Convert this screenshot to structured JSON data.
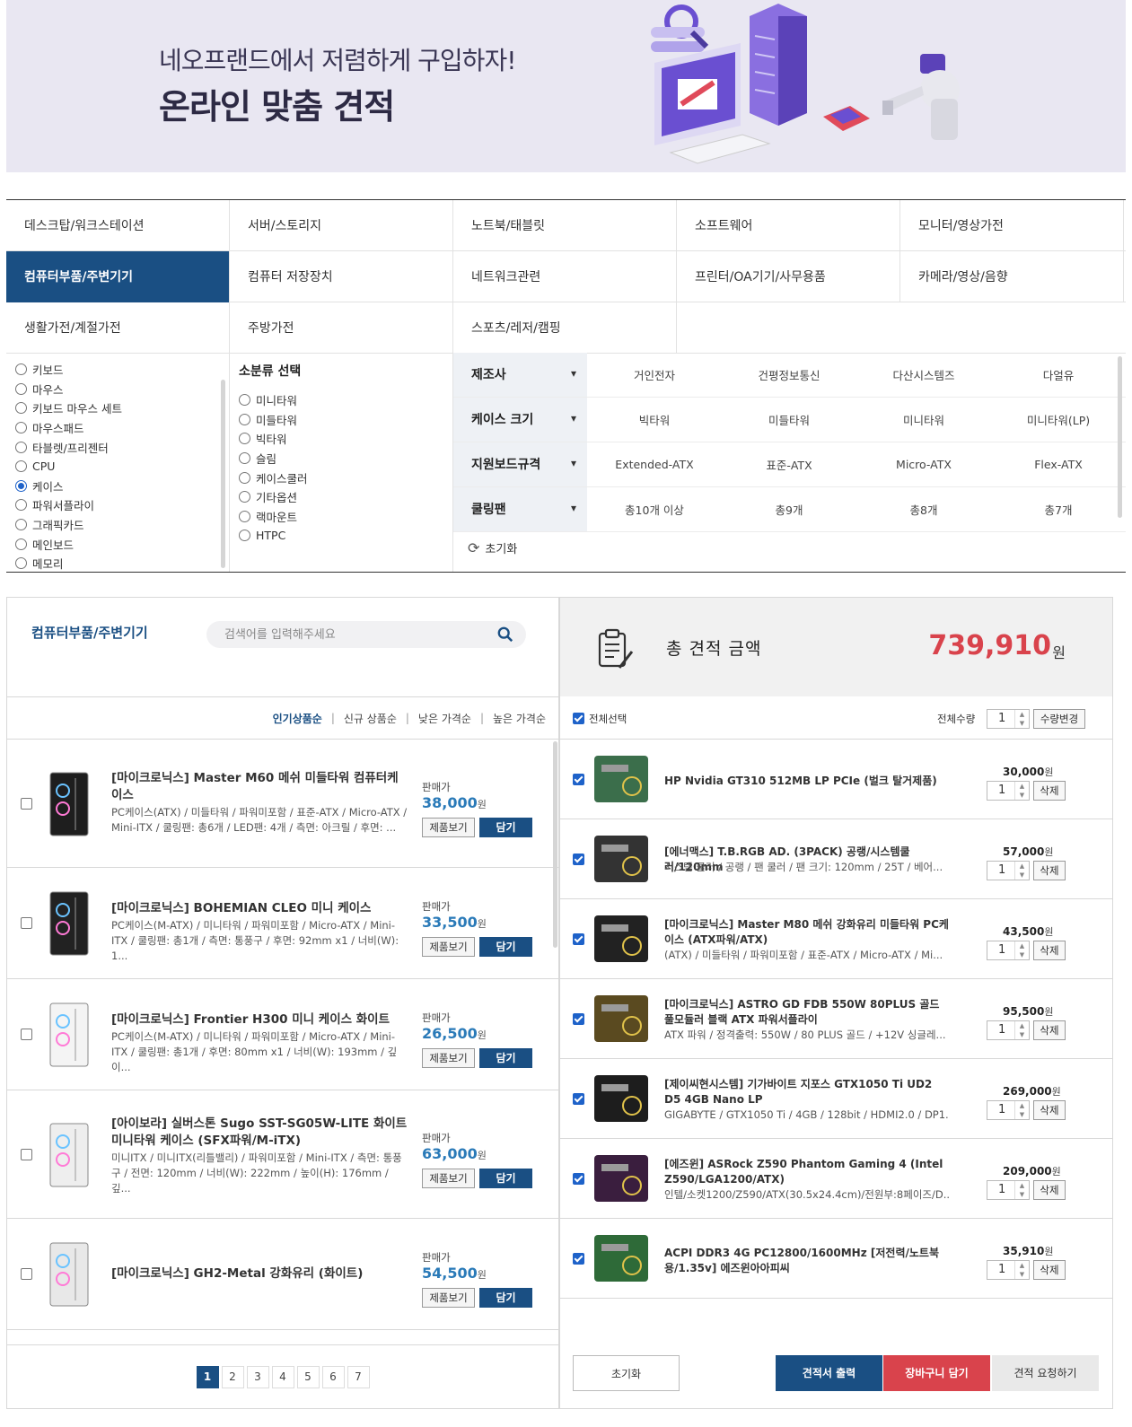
{
  "banner": {
    "subtitle": "네오프랜드에서 저렴하게 구입하자!",
    "title": "온라인 맞춤 견적"
  },
  "categories": [
    [
      "데스크탑/워크스테이션",
      "서버/스토리지",
      "노트북/태블릿",
      "소프트웨어",
      "모니터/영상가전"
    ],
    [
      "컴퓨터부품/주변기기",
      "컴퓨터 저장장치",
      "네트워크관련",
      "프린터/OA기기/사무용품",
      "카메라/영상/음향"
    ],
    [
      "생활가전/계절가전",
      "주방가전",
      "스포츠/레저/캠핑"
    ]
  ],
  "active_category": "컴퓨터부품/주변기기",
  "subcategories": [
    "키보드",
    "마우스",
    "키보드 마우스 세트",
    "마우스패드",
    "타블렛/프리젠터",
    "CPU",
    "케이스",
    "파워서플라이",
    "그래픽카드",
    "메인보드",
    "메모리"
  ],
  "active_subcategory": "케이스",
  "minor_head": "소분류 선택",
  "minor_options": [
    "미니타워",
    "미들타워",
    "빅타워",
    "슬림",
    "케이스쿨러",
    "기타옵션",
    "랙마운트",
    "HTPC"
  ],
  "filters": [
    {
      "key": "제조사",
      "values": [
        "거인전자",
        "건평정보통신",
        "다산시스템즈",
        "다얼유"
      ]
    },
    {
      "key": "케이스 크기",
      "values": [
        "빅타워",
        "미들타워",
        "미니타워",
        "미니타워(LP)"
      ]
    },
    {
      "key": "지원보드규격",
      "values": [
        "Extended-ATX",
        "표준-ATX",
        "Micro-ATX",
        "Flex-ATX"
      ]
    },
    {
      "key": "쿨링팬",
      "values": [
        "총10개 이상",
        "총9개",
        "총8개",
        "총7개"
      ]
    }
  ],
  "filter_reset": "초기화",
  "left": {
    "title": "컴퓨터부품/주변기기",
    "search_placeholder": "검색어를 입력해주세요",
    "sort": [
      "인기상품순",
      "신규 상품순",
      "낮은 가격순",
      "높은 가격순"
    ],
    "price_label": "판매가",
    "won": "원",
    "view_label": "제품보기",
    "add_label": "담기",
    "products": [
      {
        "name": "[마이크로닉스] Master M60 메쉬 미들타워 컴퓨터케이스",
        "desc": "PC케이스(ATX) / 미들타워 / 파워미포함 / 표준-ATX / Micro-ATX / Mini-ITX / 쿨링팬: 총6개 / LED팬: 4개 / 측면: 아크릴 / 후면: ...",
        "price": "38,000"
      },
      {
        "name": "[마이크로닉스] BOHEMIAN CLEO 미니 케이스",
        "desc": "PC케이스(M-ATX) / 미니타워 / 파워미포함 / Micro-ATX / Mini-ITX / 쿨링팬: 총1개 / 측면: 통풍구 / 후면: 92mm x1 / 너비(W): 1...",
        "price": "33,500"
      },
      {
        "name": "[마이크로닉스] Frontier H300 미니 케이스 화이트",
        "desc": "PC케이스(M-ATX) / 미니타워 / 파워미포함 / Micro-ATX / Mini-ITX / 쿨링팬: 총1개 / 후면: 80mm x1 / 너비(W): 193mm / 깊이...",
        "price": "26,500"
      },
      {
        "name": "[아이보라] 실버스톤 Sugo SST-SG05W-LITE 화이트 미니타워 케이스 (SFX파워/M-iTX)",
        "desc": "미니ITX / 미니ITX(리틀밸리) / 파워미포함 / Mini-ITX / 측면: 통풍구 / 전면: 120mm / 너비(W): 222mm / 높이(H): 176mm / 깊...",
        "price": "63,000"
      },
      {
        "name": "[마이크로닉스] GH2-Metal 강화유리 (화이트)",
        "desc": "",
        "price": "54,500"
      }
    ],
    "pages": [
      "1",
      "2",
      "3",
      "4",
      "5",
      "6",
      "7"
    ]
  },
  "right": {
    "total_label": "총 견적 금액",
    "total_amount": "739,910",
    "won": "원",
    "select_all": "전체선택",
    "qty_label": "전체수량",
    "qty_value": "1",
    "qty_change": "수량변경",
    "delete_label": "삭제",
    "items": [
      {
        "name": "HP Nvidia GT310 512MB LP PCIe (벌크 탈거제품)",
        "desc": "",
        "price": "30,000",
        "qty": "1"
      },
      {
        "name": "[에너맥스] T.B.RGB AD. (3PACK) 공랭/시스템쿨러/120mm",
        "desc": "시스템 쿨러 / 공랭 / 팬 쿨러 / 팬 크기: 120mm / 25T / 베어...",
        "price": "57,000",
        "qty": "1"
      },
      {
        "name": "[마이크로닉스] Master M80 메쉬 강화유리 미들타워 PC케이스 (ATX파워/ATX)",
        "desc": "(ATX) / 미들타워 / 파워미포함 / 표준-ATX / Micro-ATX / Mi...",
        "price": "43,500",
        "qty": "1"
      },
      {
        "name": "[마이크로닉스] ASTRO GD FDB 550W 80PLUS 골드 풀모듈러 블랙 ATX 파워서플라이",
        "desc": "ATX 파워 / 정격출력: 550W / 80 PLUS 골드 / +12V 싱글레...",
        "price": "95,500",
        "qty": "1"
      },
      {
        "name": "[제이씨현시스템] 기가바이트 지포스 GTX1050 Ti UD2 D5 4GB Nano LP",
        "desc": "GIGABYTE / GTX1050 Ti / 4GB / 128bit / HDMI2.0 / DP1...",
        "price": "269,000",
        "qty": "1"
      },
      {
        "name": "[에즈윈] ASRock Z590 Phantom Gaming 4 (Intel Z590/LGA1200/ATX)",
        "desc": "인텔/소켓1200/Z590/ATX(30.5x24.4cm)/전원부:8페이즈/D...",
        "price": "209,000",
        "qty": "1"
      },
      {
        "name": "ACPI DDR3 4G PC12800/1600MHz [저전력/노트북용/1.35v] 에즈윈아아피씨",
        "desc": "",
        "price": "35,910",
        "qty": "1"
      }
    ],
    "reset": "초기화",
    "print": "견적서 출력",
    "cart": "장바구니 담기",
    "request": "견적 요청하기"
  }
}
